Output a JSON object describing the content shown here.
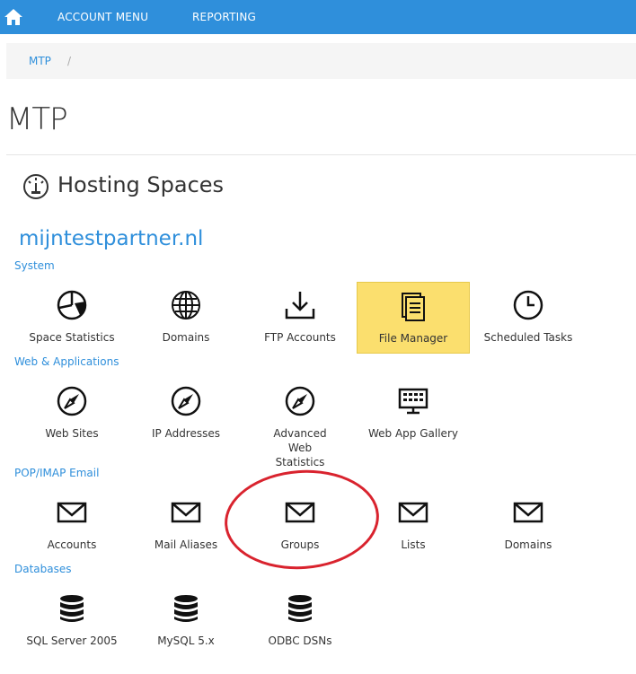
{
  "topbar": {
    "menu_items": [
      "ACCOUNT MENU",
      "REPORTING"
    ]
  },
  "breadcrumb": {
    "items": [
      "MTP"
    ],
    "separator": "/"
  },
  "page": {
    "title": "MTP"
  },
  "section": {
    "title": "Hosting Spaces"
  },
  "space": {
    "name": "mijntestpartner.nl"
  },
  "groups": [
    {
      "label": "System",
      "items": [
        {
          "label": "Space Statistics",
          "icon": "pie-chart-icon"
        },
        {
          "label": "Domains",
          "icon": "globe-icon"
        },
        {
          "label": "FTP Accounts",
          "icon": "download-icon"
        },
        {
          "label": "File Manager",
          "icon": "document-icon",
          "selected": true
        },
        {
          "label": "Scheduled Tasks",
          "icon": "clock-icon"
        }
      ]
    },
    {
      "label": "Web & Applications",
      "items": [
        {
          "label": "Web Sites",
          "icon": "compass-icon"
        },
        {
          "label": "IP Addresses",
          "icon": "compass-icon"
        },
        {
          "label": "Advanced Web Statistics",
          "icon": "compass-icon"
        },
        {
          "label": "Web App Gallery",
          "icon": "monitor-grid-icon"
        }
      ]
    },
    {
      "label": "POP/IMAP Email",
      "items": [
        {
          "label": "Accounts",
          "icon": "envelope-icon"
        },
        {
          "label": "Mail Aliases",
          "icon": "envelope-icon"
        },
        {
          "label": "Groups",
          "icon": "envelope-icon"
        },
        {
          "label": "Lists",
          "icon": "envelope-icon"
        },
        {
          "label": "Domains",
          "icon": "envelope-icon"
        }
      ]
    },
    {
      "label": "Databases",
      "items": [
        {
          "label": "SQL Server 2005",
          "icon": "database-icon"
        },
        {
          "label": "MySQL 5.x",
          "icon": "database-icon"
        },
        {
          "label": "ODBC DSNs",
          "icon": "database-icon"
        }
      ]
    }
  ],
  "colors": {
    "topbar": "#2f8fdb",
    "accent": "#2f8fdb",
    "highlight": "#fbdf6e",
    "annotation": "#d9232e"
  }
}
